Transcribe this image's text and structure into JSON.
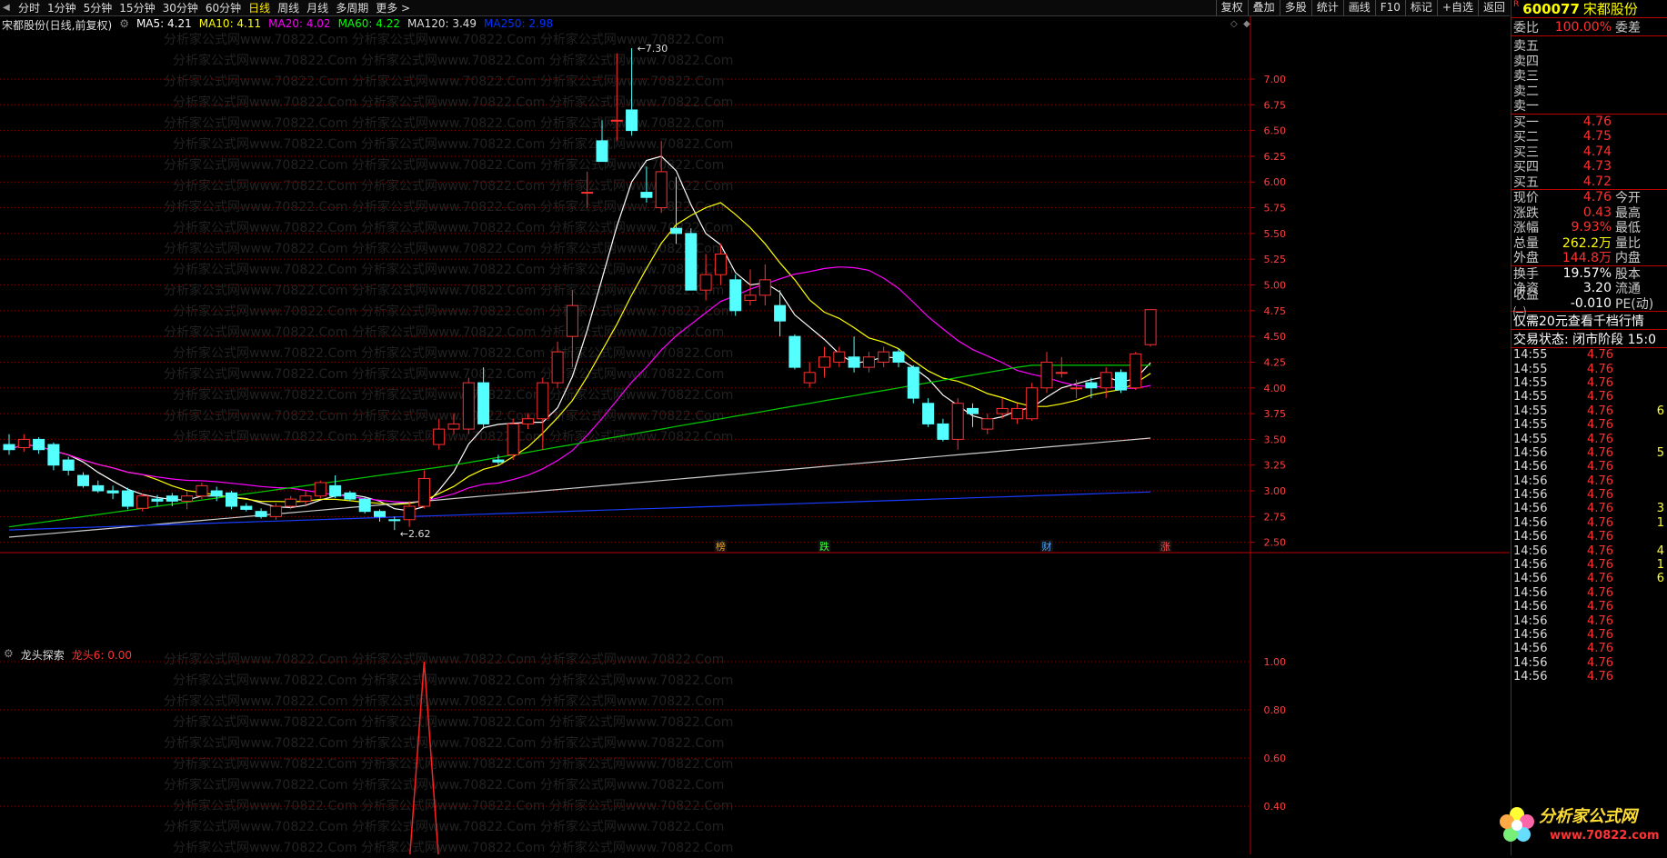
{
  "toolbar": {
    "tabs": [
      "分时",
      "1分钟",
      "5分钟",
      "15分钟",
      "30分钟",
      "60分钟",
      "日线",
      "周线",
      "月线",
      "多周期",
      "更多 >"
    ],
    "active_tab": "日线",
    "right_buttons": [
      "复权",
      "叠加",
      "多股",
      "统计",
      "画线",
      "F10",
      "标记",
      "+自选",
      "返回"
    ]
  },
  "main": {
    "title": "宋都股份(日线,前复权)",
    "ma_legend": [
      {
        "label": "MA5: 4.21",
        "color": "#ffffff"
      },
      {
        "label": "MA10: 4.11",
        "color": "#ffff00"
      },
      {
        "label": "MA20: 4.02",
        "color": "#ff00ff"
      },
      {
        "label": "MA60: 4.22",
        "color": "#00ff00"
      },
      {
        "label": "MA120: 3.49",
        "color": "#dddddd"
      },
      {
        "label": "MA250: 2.98",
        "color": "#0033ff"
      }
    ],
    "high_label": "7.30",
    "low_label": "2.62",
    "watermark": "分析家公式网www.70822.Com",
    "markers": [
      "榜",
      "跌",
      "财",
      "涨"
    ],
    "y_ticks": [
      "7.00",
      "6.75",
      "6.50",
      "6.25",
      "6.00",
      "5.75",
      "5.50",
      "5.25",
      "5.00",
      "4.75",
      "4.50",
      "4.25",
      "4.00",
      "3.75",
      "3.50",
      "3.25",
      "3.00",
      "2.75",
      "2.50"
    ]
  },
  "sub": {
    "title": "龙头探索",
    "indicator": "龙头6: 0.00",
    "y_ticks": [
      "1.00",
      "0.80",
      "0.60",
      "0.40"
    ]
  },
  "colors": {
    "up": "#ff3030",
    "down": "#54ffff",
    "grid": "#8b0000"
  },
  "chart_data": {
    "type": "candlestick",
    "ylim": [
      2.4,
      7.45
    ],
    "candles": [
      [
        3.45,
        3.4,
        3.55,
        3.35
      ],
      [
        3.42,
        3.5,
        3.55,
        3.38
      ],
      [
        3.5,
        3.4,
        3.52,
        3.36
      ],
      [
        3.45,
        3.25,
        3.47,
        3.2
      ],
      [
        3.3,
        3.2,
        3.33,
        3.15
      ],
      [
        3.15,
        3.05,
        3.18,
        3.03
      ],
      [
        3.05,
        3.0,
        3.1,
        2.98
      ],
      [
        3.0,
        2.98,
        3.05,
        2.92
      ],
      [
        3.0,
        2.85,
        3.03,
        2.82
      ],
      [
        2.83,
        2.95,
        2.97,
        2.8
      ],
      [
        2.92,
        2.9,
        2.96,
        2.85
      ],
      [
        2.95,
        2.9,
        2.98,
        2.85
      ],
      [
        2.9,
        2.95,
        3.0,
        2.82
      ],
      [
        2.95,
        3.05,
        3.08,
        2.92
      ],
      [
        3.0,
        2.95,
        3.04,
        2.9
      ],
      [
        2.98,
        2.85,
        3.0,
        2.82
      ],
      [
        2.85,
        2.82,
        2.88,
        2.8
      ],
      [
        2.8,
        2.75,
        2.83,
        2.73
      ],
      [
        2.75,
        2.85,
        2.88,
        2.72
      ],
      [
        2.85,
        2.92,
        2.95,
        2.82
      ],
      [
        2.9,
        2.95,
        3.0,
        2.86
      ],
      [
        2.95,
        3.08,
        3.1,
        2.93
      ],
      [
        3.05,
        2.95,
        3.15,
        2.93
      ],
      [
        2.98,
        2.92,
        3.0,
        2.9
      ],
      [
        2.92,
        2.8,
        2.94,
        2.78
      ],
      [
        2.8,
        2.75,
        2.82,
        2.7
      ],
      [
        2.72,
        2.71,
        2.75,
        2.62
      ],
      [
        2.72,
        2.85,
        2.9,
        2.65
      ],
      [
        2.85,
        3.12,
        3.2,
        2.83
      ],
      [
        3.45,
        3.6,
        3.7,
        3.4
      ],
      [
        3.6,
        3.65,
        3.75,
        3.55
      ],
      [
        3.6,
        4.05,
        4.1,
        3.55
      ],
      [
        4.05,
        3.65,
        4.2,
        3.6
      ],
      [
        3.3,
        3.28,
        3.35,
        3.25
      ],
      [
        3.35,
        3.65,
        3.7,
        3.3
      ],
      [
        3.65,
        3.7,
        3.75,
        3.6
      ],
      [
        3.7,
        4.05,
        4.1,
        3.4
      ],
      [
        4.05,
        4.35,
        4.45,
        4.0
      ],
      [
        4.5,
        4.8,
        4.95,
        4.2
      ],
      [
        5.9,
        5.9,
        6.1,
        5.75
      ],
      [
        6.4,
        6.2,
        6.6,
        6.3
      ],
      [
        6.6,
        6.6,
        7.25,
        6.4
      ],
      [
        6.7,
        6.5,
        7.3,
        6.45
      ],
      [
        5.9,
        5.85,
        6.15,
        5.8
      ],
      [
        5.75,
        6.1,
        6.4,
        5.7
      ],
      [
        5.55,
        5.5,
        6.05,
        5.4
      ],
      [
        5.5,
        4.95,
        5.55,
        4.95
      ],
      [
        4.95,
        5.1,
        5.3,
        4.85
      ],
      [
        5.1,
        5.3,
        5.4,
        5.0
      ],
      [
        5.05,
        4.75,
        5.1,
        4.7
      ],
      [
        4.85,
        4.9,
        5.15,
        4.8
      ],
      [
        4.9,
        5.05,
        5.2,
        4.8
      ],
      [
        4.8,
        4.65,
        4.95,
        4.5
      ],
      [
        4.5,
        4.2,
        4.52,
        4.18
      ],
      [
        4.05,
        4.15,
        4.25,
        4.0
      ],
      [
        4.2,
        4.3,
        4.4,
        4.1
      ],
      [
        4.25,
        4.35,
        4.4,
        4.2
      ],
      [
        4.3,
        4.2,
        4.5,
        4.15
      ],
      [
        4.2,
        4.3,
        4.35,
        4.15
      ],
      [
        4.25,
        4.35,
        4.4,
        4.2
      ],
      [
        4.35,
        4.25,
        4.38,
        4.2
      ],
      [
        4.2,
        3.9,
        4.22,
        3.85
      ],
      [
        3.85,
        3.65,
        3.9,
        3.62
      ],
      [
        3.65,
        3.5,
        3.7,
        3.48
      ],
      [
        3.5,
        3.85,
        3.9,
        3.4
      ],
      [
        3.8,
        3.75,
        3.85,
        3.62
      ],
      [
        3.6,
        3.7,
        3.75,
        3.55
      ],
      [
        3.75,
        3.8,
        3.9,
        3.7
      ],
      [
        3.7,
        3.8,
        3.85,
        3.65
      ],
      [
        3.7,
        4.0,
        4.05,
        3.68
      ],
      [
        4.0,
        4.25,
        4.35,
        3.95
      ],
      [
        4.15,
        4.15,
        4.3,
        4.1
      ],
      [
        4.0,
        4.0,
        4.08,
        3.9
      ],
      [
        4.05,
        4.0,
        4.1,
        3.9
      ],
      [
        4.0,
        4.15,
        4.2,
        3.9
      ],
      [
        4.15,
        3.98,
        4.18,
        3.95
      ],
      [
        4.0,
        4.33,
        4.35,
        3.98
      ],
      [
        4.42,
        4.76,
        4.76,
        4.4
      ]
    ],
    "sub_series": {
      "spike_index": 27,
      "value": 1.0
    }
  },
  "right": {
    "code": "600077",
    "name": "宋都股份",
    "r_badge": "R",
    "weibi_label": "委比",
    "weibi_value": "100.00%",
    "weicha_label": "委差",
    "sells": [
      "卖五",
      "卖四",
      "卖三",
      "卖二",
      "卖一"
    ],
    "buys": [
      {
        "label": "买一",
        "price": "4.76"
      },
      {
        "label": "买二",
        "price": "4.75"
      },
      {
        "label": "买三",
        "price": "4.74"
      },
      {
        "label": "买四",
        "price": "4.73"
      },
      {
        "label": "买五",
        "price": "4.72"
      }
    ],
    "stats": [
      {
        "l": "现价",
        "v": "4.76",
        "r": "今开",
        "vc": "#ff3030"
      },
      {
        "l": "涨跌",
        "v": "0.43",
        "r": "最高",
        "vc": "#ff3030"
      },
      {
        "l": "涨幅",
        "v": "9.93%",
        "r": "最低",
        "vc": "#ff3030"
      },
      {
        "l": "总量",
        "v": "262.2万",
        "r": "量比",
        "vc": "#ffff00"
      },
      {
        "l": "外盘",
        "v": "144.8万",
        "r": "内盘",
        "vc": "#ff3030"
      }
    ],
    "stats2": [
      {
        "l": "换手",
        "v": "19.57%",
        "r": "股本",
        "vc": "#ffffff"
      },
      {
        "l": "净资",
        "v": "3.20",
        "r": "流通",
        "vc": "#ffffff"
      },
      {
        "l": "收益㈠",
        "v": "-0.010",
        "r": "PE(动)",
        "vc": "#ffffff"
      }
    ],
    "notice": "仅需20元查看千档行情",
    "trade_state": "交易状态: 闭市阶段 15:0",
    "ticks": [
      [
        "14:55",
        "4.76",
        ""
      ],
      [
        "14:55",
        "4.76",
        ""
      ],
      [
        "14:55",
        "4.76",
        ""
      ],
      [
        "14:55",
        "4.76",
        ""
      ],
      [
        "14:55",
        "4.76",
        "6"
      ],
      [
        "14:55",
        "4.76",
        ""
      ],
      [
        "14:55",
        "4.76",
        ""
      ],
      [
        "14:56",
        "4.76",
        "5"
      ],
      [
        "14:56",
        "4.76",
        ""
      ],
      [
        "14:56",
        "4.76",
        ""
      ],
      [
        "14:56",
        "4.76",
        ""
      ],
      [
        "14:56",
        "4.76",
        "3"
      ],
      [
        "14:56",
        "4.76",
        "1"
      ],
      [
        "14:56",
        "4.76",
        ""
      ],
      [
        "14:56",
        "4.76",
        "4"
      ],
      [
        "14:56",
        "4.76",
        "1"
      ],
      [
        "14:56",
        "4.76",
        "6"
      ],
      [
        "14:56",
        "4.76",
        ""
      ],
      [
        "14:56",
        "4.76",
        ""
      ],
      [
        "14:56",
        "4.76",
        ""
      ],
      [
        "14:56",
        "4.76",
        ""
      ],
      [
        "14:56",
        "4.76",
        ""
      ],
      [
        "14:56",
        "4.76",
        ""
      ],
      [
        "14:56",
        "4.76",
        ""
      ]
    ],
    "logo_text": "分析家公式网",
    "logo_url": "www.70822.com"
  }
}
